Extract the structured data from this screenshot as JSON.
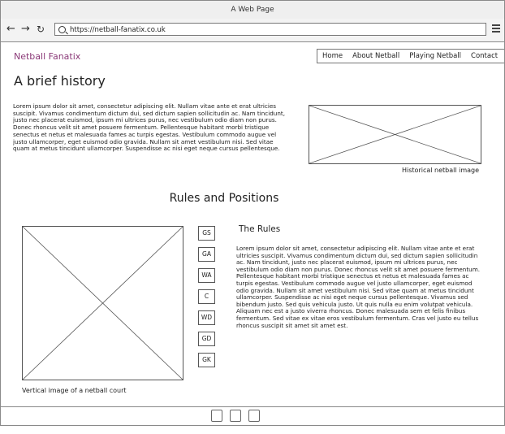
{
  "window": {
    "title": "A Web Page"
  },
  "toolbar": {
    "back_icon": "arrow-left-icon",
    "forward_icon": "arrow-right-icon",
    "reload_icon": "reload-icon",
    "url": "https://netball-fanatix.co.uk",
    "menu_icon": "hamburger-menu-icon"
  },
  "header": {
    "brand": "Netball Fanatix",
    "brand_color": "#8b3a78",
    "nav": [
      "Home",
      "About Netball",
      "Playing Netball",
      "Contact"
    ]
  },
  "history": {
    "title": "A brief history",
    "text": "Lorem ipsum dolor sit amet, consectetur adipiscing elit. Nullam vitae ante et erat ultricies suscipit. Vivamus condimentum dictum dui, sed dictum sapien sollicitudin ac. Nam tincidunt, justo nec placerat euismod, ipsum mi ultrices purus, nec vestibulum odio diam non purus. Donec rhoncus velit sit amet posuere fermentum. Pellentesque habitant morbi tristique senectus et netus et malesuada fames ac turpis egestas. Vestibulum commodo augue vel justo ullamcorper, eget euismod odio gravida. Nullam sit amet vestibulum nisi. Sed vitae quam at metus tincidunt ullamcorper. Suspendisse ac nisi eget neque cursus pellentesque.",
    "image_caption": "Historical netball image"
  },
  "rules": {
    "title": "Rules and Positions",
    "positions": [
      "GS",
      "GA",
      "WA",
      "C",
      "WD",
      "GD",
      "GK"
    ],
    "court_caption": "Vertical image of a netball court",
    "subtitle": "The Rules",
    "text": "Lorem ipsum dolor sit amet, consectetur adipiscing elit. Nullam vitae ante et erat ultricies suscipit. Vivamus condimentum dictum dui, sed dictum sapien sollicitudin ac. Nam tincidunt, justo nec placerat euismod, ipsum mi ultrices purus, nec vestibulum odio diam non purus. Donec rhoncus velit sit amet posuere fermentum. Pellentesque habitant morbi tristique senectus et netus et malesuada fames ac turpis egestas. Vestibulum commodo augue vel justo ullamcorper, eget euismod odio gravida. Nullam sit amet vestibulum nisi. Sed vitae quam at metus tincidunt ullamcorper. Suspendisse ac nisi eget neque cursus pellentesque. Vivamus sed bibendum justo. Sed quis vehicula justo. Ut quis nulla eu enim volutpat vehicula. Aliquam nec est a justo viverra rhoncus. Donec malesuada sem et felis finibus fermentum. Sed vitae ex vitae eros vestibulum fermentum. Cras vel justo eu tellus rhoncus suscipit sit amet sit amet est."
  }
}
